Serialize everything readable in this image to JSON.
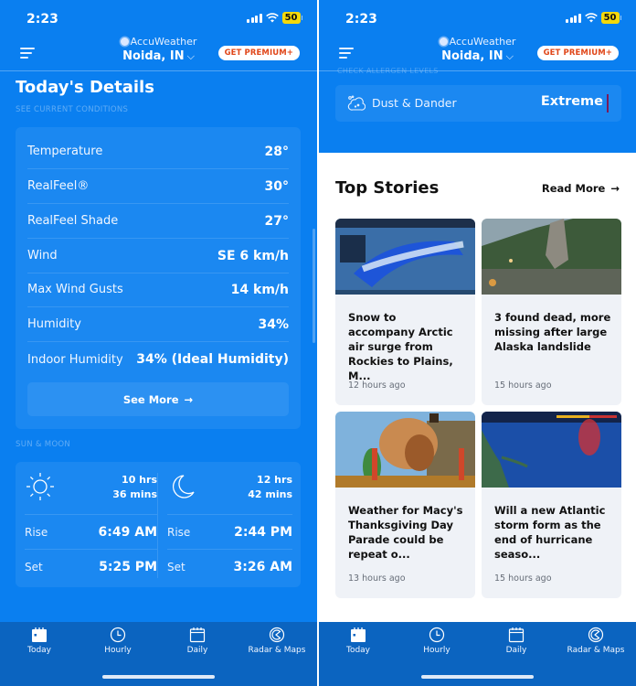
{
  "status_bar": {
    "time": "2:23",
    "battery": "50"
  },
  "header": {
    "brand": "AccuWeather",
    "location": "Noida, IN",
    "premium_label": "GET PREMIUM+"
  },
  "left": {
    "section_title": "Today's Details",
    "section_subtitle": "SEE CURRENT CONDITIONS",
    "details": [
      {
        "label": "Temperature",
        "value": "28°"
      },
      {
        "label": "RealFeel®",
        "value": "30°"
      },
      {
        "label": "RealFeel Shade",
        "value": "27°"
      },
      {
        "label": "Wind",
        "value": "SE 6 km/h"
      },
      {
        "label": "Max Wind Gusts",
        "value": "14 km/h"
      },
      {
        "label": "Humidity",
        "value": "34%"
      },
      {
        "label": "Indoor Humidity",
        "value": "34% (Ideal Humidity)"
      }
    ],
    "see_more_label": "See More",
    "sun_moon_label": "SUN & MOON",
    "sun": {
      "duration_line1": "10 hrs",
      "duration_line2": "36 mins",
      "rise_label": "Rise",
      "rise": "6:49 AM",
      "set_label": "Set",
      "set": "5:25 PM"
    },
    "moon": {
      "duration_line1": "12 hrs",
      "duration_line2": "42 mins",
      "rise_label": "Rise",
      "rise": "2:44 PM",
      "set_label": "Set",
      "set": "3:26 AM"
    }
  },
  "right": {
    "ghost_label": "CHECK ALLERGEN LEVELS",
    "allergen": {
      "label": "Dust & Dander",
      "value": "Extreme",
      "level_color": "#7a1a5a"
    },
    "top_stories_title": "Top Stories",
    "read_more_label": "Read More",
    "stories": [
      {
        "headline": "Snow to accompany Arctic air surge from Rockies to Plains, M...",
        "ago": "12 hours ago",
        "thumb": "snow-potential-map"
      },
      {
        "headline": "3 found dead, more missing after large Alaska landslide",
        "ago": "15 hours ago",
        "thumb": "landslide-photo"
      },
      {
        "headline": "Weather for Macy's Thanksgiving Day Parade could be repeat o...",
        "ago": "13 hours ago",
        "thumb": "parade-turkey-float"
      },
      {
        "headline": "Will a new Atlantic storm form as the end of hurricane seaso...",
        "ago": "15 hours ago",
        "thumb": "tropical-tracker-map"
      }
    ]
  },
  "tabs": [
    {
      "label": "Today",
      "icon": "calendar-today-icon",
      "active": true
    },
    {
      "label": "Hourly",
      "icon": "clock-icon",
      "active": false
    },
    {
      "label": "Daily",
      "icon": "calendar-icon",
      "active": false
    },
    {
      "label": "Radar & Maps",
      "icon": "radar-icon",
      "active": false
    }
  ],
  "colors": {
    "brand_blue": "#0a7ff0",
    "tabbar_blue": "#0b64c0",
    "premium_text": "#e0471a",
    "battery": "#f5d90a"
  }
}
